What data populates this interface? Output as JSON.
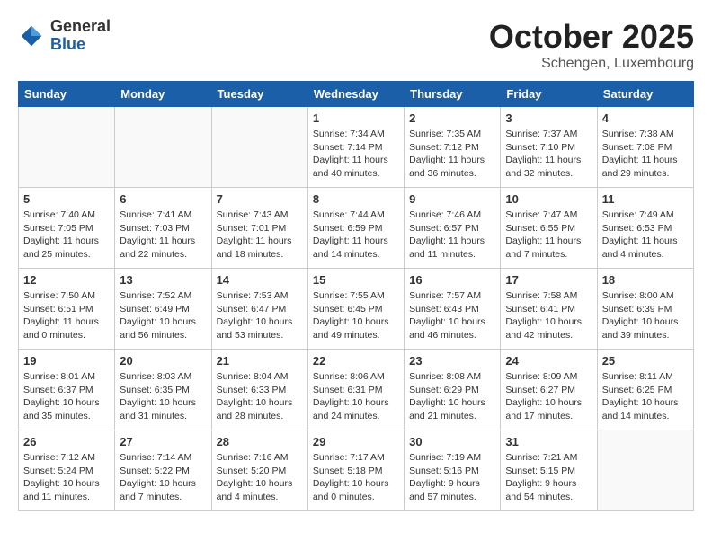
{
  "header": {
    "logo_general": "General",
    "logo_blue": "Blue",
    "month": "October 2025",
    "location": "Schengen, Luxembourg"
  },
  "days_of_week": [
    "Sunday",
    "Monday",
    "Tuesday",
    "Wednesday",
    "Thursday",
    "Friday",
    "Saturday"
  ],
  "weeks": [
    [
      {
        "day": "",
        "info": ""
      },
      {
        "day": "",
        "info": ""
      },
      {
        "day": "",
        "info": ""
      },
      {
        "day": "1",
        "info": "Sunrise: 7:34 AM\nSunset: 7:14 PM\nDaylight: 11 hours\nand 40 minutes."
      },
      {
        "day": "2",
        "info": "Sunrise: 7:35 AM\nSunset: 7:12 PM\nDaylight: 11 hours\nand 36 minutes."
      },
      {
        "day": "3",
        "info": "Sunrise: 7:37 AM\nSunset: 7:10 PM\nDaylight: 11 hours\nand 32 minutes."
      },
      {
        "day": "4",
        "info": "Sunrise: 7:38 AM\nSunset: 7:08 PM\nDaylight: 11 hours\nand 29 minutes."
      }
    ],
    [
      {
        "day": "5",
        "info": "Sunrise: 7:40 AM\nSunset: 7:05 PM\nDaylight: 11 hours\nand 25 minutes."
      },
      {
        "day": "6",
        "info": "Sunrise: 7:41 AM\nSunset: 7:03 PM\nDaylight: 11 hours\nand 22 minutes."
      },
      {
        "day": "7",
        "info": "Sunrise: 7:43 AM\nSunset: 7:01 PM\nDaylight: 11 hours\nand 18 minutes."
      },
      {
        "day": "8",
        "info": "Sunrise: 7:44 AM\nSunset: 6:59 PM\nDaylight: 11 hours\nand 14 minutes."
      },
      {
        "day": "9",
        "info": "Sunrise: 7:46 AM\nSunset: 6:57 PM\nDaylight: 11 hours\nand 11 minutes."
      },
      {
        "day": "10",
        "info": "Sunrise: 7:47 AM\nSunset: 6:55 PM\nDaylight: 11 hours\nand 7 minutes."
      },
      {
        "day": "11",
        "info": "Sunrise: 7:49 AM\nSunset: 6:53 PM\nDaylight: 11 hours\nand 4 minutes."
      }
    ],
    [
      {
        "day": "12",
        "info": "Sunrise: 7:50 AM\nSunset: 6:51 PM\nDaylight: 11 hours\nand 0 minutes."
      },
      {
        "day": "13",
        "info": "Sunrise: 7:52 AM\nSunset: 6:49 PM\nDaylight: 10 hours\nand 56 minutes."
      },
      {
        "day": "14",
        "info": "Sunrise: 7:53 AM\nSunset: 6:47 PM\nDaylight: 10 hours\nand 53 minutes."
      },
      {
        "day": "15",
        "info": "Sunrise: 7:55 AM\nSunset: 6:45 PM\nDaylight: 10 hours\nand 49 minutes."
      },
      {
        "day": "16",
        "info": "Sunrise: 7:57 AM\nSunset: 6:43 PM\nDaylight: 10 hours\nand 46 minutes."
      },
      {
        "day": "17",
        "info": "Sunrise: 7:58 AM\nSunset: 6:41 PM\nDaylight: 10 hours\nand 42 minutes."
      },
      {
        "day": "18",
        "info": "Sunrise: 8:00 AM\nSunset: 6:39 PM\nDaylight: 10 hours\nand 39 minutes."
      }
    ],
    [
      {
        "day": "19",
        "info": "Sunrise: 8:01 AM\nSunset: 6:37 PM\nDaylight: 10 hours\nand 35 minutes."
      },
      {
        "day": "20",
        "info": "Sunrise: 8:03 AM\nSunset: 6:35 PM\nDaylight: 10 hours\nand 31 minutes."
      },
      {
        "day": "21",
        "info": "Sunrise: 8:04 AM\nSunset: 6:33 PM\nDaylight: 10 hours\nand 28 minutes."
      },
      {
        "day": "22",
        "info": "Sunrise: 8:06 AM\nSunset: 6:31 PM\nDaylight: 10 hours\nand 24 minutes."
      },
      {
        "day": "23",
        "info": "Sunrise: 8:08 AM\nSunset: 6:29 PM\nDaylight: 10 hours\nand 21 minutes."
      },
      {
        "day": "24",
        "info": "Sunrise: 8:09 AM\nSunset: 6:27 PM\nDaylight: 10 hours\nand 17 minutes."
      },
      {
        "day": "25",
        "info": "Sunrise: 8:11 AM\nSunset: 6:25 PM\nDaylight: 10 hours\nand 14 minutes."
      }
    ],
    [
      {
        "day": "26",
        "info": "Sunrise: 7:12 AM\nSunset: 5:24 PM\nDaylight: 10 hours\nand 11 minutes."
      },
      {
        "day": "27",
        "info": "Sunrise: 7:14 AM\nSunset: 5:22 PM\nDaylight: 10 hours\nand 7 minutes."
      },
      {
        "day": "28",
        "info": "Sunrise: 7:16 AM\nSunset: 5:20 PM\nDaylight: 10 hours\nand 4 minutes."
      },
      {
        "day": "29",
        "info": "Sunrise: 7:17 AM\nSunset: 5:18 PM\nDaylight: 10 hours\nand 0 minutes."
      },
      {
        "day": "30",
        "info": "Sunrise: 7:19 AM\nSunset: 5:16 PM\nDaylight: 9 hours\nand 57 minutes."
      },
      {
        "day": "31",
        "info": "Sunrise: 7:21 AM\nSunset: 5:15 PM\nDaylight: 9 hours\nand 54 minutes."
      },
      {
        "day": "",
        "info": ""
      }
    ]
  ]
}
